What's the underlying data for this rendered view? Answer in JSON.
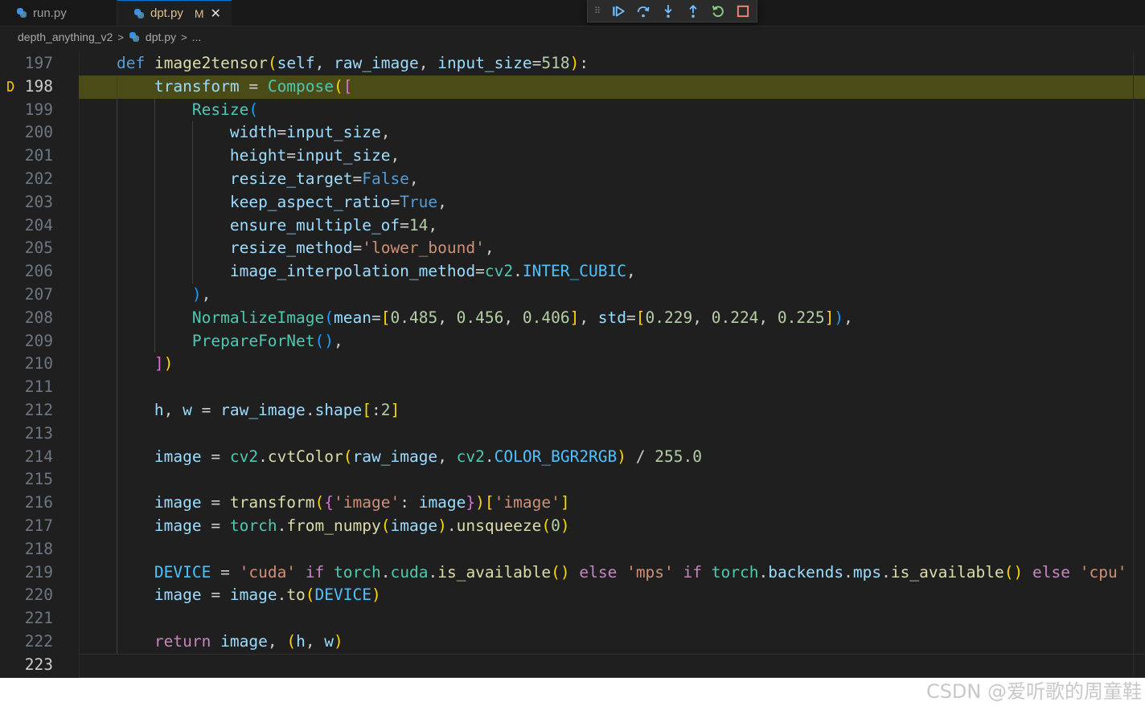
{
  "tabs": [
    {
      "label": "run.py",
      "active": false
    },
    {
      "label": "dpt.py",
      "active": true,
      "badge": "M",
      "close": "✕"
    }
  ],
  "breadcrumb": {
    "folder": "depth_anything_v2",
    "file": "dpt.py",
    "symbol": "..."
  },
  "debug_toolbar": [
    {
      "name": "continue",
      "icon": "continue-icon"
    },
    {
      "name": "step-over",
      "icon": "step-over-icon"
    },
    {
      "name": "step-into",
      "icon": "step-into-icon"
    },
    {
      "name": "step-out",
      "icon": "step-out-icon"
    },
    {
      "name": "restart",
      "icon": "restart-icon"
    },
    {
      "name": "stop",
      "icon": "stop-icon"
    }
  ],
  "colors": {
    "editor_bg": "#1f1f1f",
    "current_line": "#4b4b18",
    "breakpoint": "#ffcc00",
    "debug_continue": "#75beff",
    "debug_restart": "#89d185",
    "debug_stop": "#f48771"
  },
  "code": {
    "current_line": 198,
    "lines": [
      {
        "n": "197",
        "t": [
          [
            "    ",
            ""
          ],
          [
            "def",
            "kw"
          ],
          [
            " ",
            ""
          ],
          [
            "image2tensor",
            "fn"
          ],
          [
            "(",
            "b1"
          ],
          [
            "self",
            "var"
          ],
          [
            ", ",
            "pn"
          ],
          [
            "raw_image",
            "var"
          ],
          [
            ", ",
            "pn"
          ],
          [
            "input_size",
            "var"
          ],
          [
            "=",
            "pn"
          ],
          [
            "518",
            "num"
          ],
          [
            ")",
            "b1"
          ],
          [
            ":",
            "pn"
          ]
        ]
      },
      {
        "n": "198",
        "t": [
          [
            "        ",
            ""
          ],
          [
            "transform",
            "var"
          ],
          [
            " = ",
            "pn"
          ],
          [
            "Compose",
            "cls"
          ],
          [
            "(",
            "b1"
          ],
          [
            "[",
            "b2"
          ]
        ]
      },
      {
        "n": "199",
        "t": [
          [
            "            ",
            ""
          ],
          [
            "Resize",
            "cls"
          ],
          [
            "(",
            "b3"
          ]
        ]
      },
      {
        "n": "200",
        "t": [
          [
            "                ",
            ""
          ],
          [
            "width",
            "var"
          ],
          [
            "=",
            "pn"
          ],
          [
            "input_size",
            "var"
          ],
          [
            ",",
            "pn"
          ]
        ]
      },
      {
        "n": "201",
        "t": [
          [
            "                ",
            ""
          ],
          [
            "height",
            "var"
          ],
          [
            "=",
            "pn"
          ],
          [
            "input_size",
            "var"
          ],
          [
            ",",
            "pn"
          ]
        ]
      },
      {
        "n": "202",
        "t": [
          [
            "                ",
            ""
          ],
          [
            "resize_target",
            "var"
          ],
          [
            "=",
            "pn"
          ],
          [
            "False",
            "bool"
          ],
          [
            ",",
            "pn"
          ]
        ]
      },
      {
        "n": "203",
        "t": [
          [
            "                ",
            ""
          ],
          [
            "keep_aspect_ratio",
            "var"
          ],
          [
            "=",
            "pn"
          ],
          [
            "True",
            "bool"
          ],
          [
            ",",
            "pn"
          ]
        ]
      },
      {
        "n": "204",
        "t": [
          [
            "                ",
            ""
          ],
          [
            "ensure_multiple_of",
            "var"
          ],
          [
            "=",
            "pn"
          ],
          [
            "14",
            "num"
          ],
          [
            ",",
            "pn"
          ]
        ]
      },
      {
        "n": "205",
        "t": [
          [
            "                ",
            ""
          ],
          [
            "resize_method",
            "var"
          ],
          [
            "=",
            "pn"
          ],
          [
            "'lower_bound'",
            "str"
          ],
          [
            ",",
            "pn"
          ]
        ]
      },
      {
        "n": "206",
        "t": [
          [
            "                ",
            ""
          ],
          [
            "image_interpolation_method",
            "var"
          ],
          [
            "=",
            "pn"
          ],
          [
            "cv2",
            "cls"
          ],
          [
            ".",
            "pn"
          ],
          [
            "INTER_CUBIC",
            "con"
          ],
          [
            ",",
            "pn"
          ]
        ]
      },
      {
        "n": "207",
        "t": [
          [
            "            ",
            ""
          ],
          [
            ")",
            "b3"
          ],
          [
            ",",
            "pn"
          ]
        ]
      },
      {
        "n": "208",
        "t": [
          [
            "            ",
            ""
          ],
          [
            "NormalizeImage",
            "cls"
          ],
          [
            "(",
            "b3"
          ],
          [
            "mean",
            "var"
          ],
          [
            "=",
            "pn"
          ],
          [
            "[",
            "b1"
          ],
          [
            "0.485",
            "num"
          ],
          [
            ", ",
            "pn"
          ],
          [
            "0.456",
            "num"
          ],
          [
            ", ",
            "pn"
          ],
          [
            "0.406",
            "num"
          ],
          [
            "]",
            "b1"
          ],
          [
            ", ",
            "pn"
          ],
          [
            "std",
            "var"
          ],
          [
            "=",
            "pn"
          ],
          [
            "[",
            "b1"
          ],
          [
            "0.229",
            "num"
          ],
          [
            ", ",
            "pn"
          ],
          [
            "0.224",
            "num"
          ],
          [
            ", ",
            "pn"
          ],
          [
            "0.225",
            "num"
          ],
          [
            "]",
            "b1"
          ],
          [
            ")",
            "b3"
          ],
          [
            ",",
            "pn"
          ]
        ]
      },
      {
        "n": "209",
        "t": [
          [
            "            ",
            ""
          ],
          [
            "PrepareForNet",
            "cls"
          ],
          [
            "(",
            "b3"
          ],
          [
            ")",
            "b3"
          ],
          [
            ",",
            "pn"
          ]
        ]
      },
      {
        "n": "210",
        "t": [
          [
            "        ",
            ""
          ],
          [
            "]",
            "b2"
          ],
          [
            ")",
            "b1"
          ]
        ]
      },
      {
        "n": "211",
        "t": []
      },
      {
        "n": "212",
        "t": [
          [
            "        ",
            ""
          ],
          [
            "h",
            "var"
          ],
          [
            ", ",
            "pn"
          ],
          [
            "w",
            "var"
          ],
          [
            " = ",
            "pn"
          ],
          [
            "raw_image",
            "var"
          ],
          [
            ".",
            "pn"
          ],
          [
            "shape",
            "var"
          ],
          [
            "[",
            "b1"
          ],
          [
            ":",
            "pn"
          ],
          [
            "2",
            "num"
          ],
          [
            "]",
            "b1"
          ]
        ]
      },
      {
        "n": "213",
        "t": []
      },
      {
        "n": "214",
        "t": [
          [
            "        ",
            ""
          ],
          [
            "image",
            "var"
          ],
          [
            " = ",
            "pn"
          ],
          [
            "cv2",
            "cls"
          ],
          [
            ".",
            "pn"
          ],
          [
            "cvtColor",
            "fn"
          ],
          [
            "(",
            "b1"
          ],
          [
            "raw_image",
            "var"
          ],
          [
            ", ",
            "pn"
          ],
          [
            "cv2",
            "cls"
          ],
          [
            ".",
            "pn"
          ],
          [
            "COLOR_BGR2RGB",
            "con"
          ],
          [
            ")",
            "b1"
          ],
          [
            " / ",
            "pn"
          ],
          [
            "255.0",
            "num"
          ]
        ]
      },
      {
        "n": "215",
        "t": []
      },
      {
        "n": "216",
        "t": [
          [
            "        ",
            ""
          ],
          [
            "image",
            "var"
          ],
          [
            " = ",
            "pn"
          ],
          [
            "transform",
            "fn"
          ],
          [
            "(",
            "b1"
          ],
          [
            "{",
            "b2"
          ],
          [
            "'image'",
            "str"
          ],
          [
            ": ",
            "pn"
          ],
          [
            "image",
            "var"
          ],
          [
            "}",
            "b2"
          ],
          [
            ")",
            "b1"
          ],
          [
            "[",
            "b1"
          ],
          [
            "'image'",
            "str"
          ],
          [
            "]",
            "b1"
          ]
        ]
      },
      {
        "n": "217",
        "t": [
          [
            "        ",
            ""
          ],
          [
            "image",
            "var"
          ],
          [
            " = ",
            "pn"
          ],
          [
            "torch",
            "cls"
          ],
          [
            ".",
            "pn"
          ],
          [
            "from_numpy",
            "fn"
          ],
          [
            "(",
            "b1"
          ],
          [
            "image",
            "var"
          ],
          [
            ")",
            "b1"
          ],
          [
            ".",
            "pn"
          ],
          [
            "unsqueeze",
            "fn"
          ],
          [
            "(",
            "b1"
          ],
          [
            "0",
            "num"
          ],
          [
            ")",
            "b1"
          ]
        ]
      },
      {
        "n": "218",
        "t": []
      },
      {
        "n": "219",
        "t": [
          [
            "        ",
            ""
          ],
          [
            "DEVICE",
            "con"
          ],
          [
            " = ",
            "pn"
          ],
          [
            "'cuda'",
            "str"
          ],
          [
            " ",
            ""
          ],
          [
            "if",
            "ctl"
          ],
          [
            " ",
            ""
          ],
          [
            "torch",
            "cls"
          ],
          [
            ".",
            "pn"
          ],
          [
            "cuda",
            "cls"
          ],
          [
            ".",
            "pn"
          ],
          [
            "is_available",
            "fn"
          ],
          [
            "(",
            "b1"
          ],
          [
            ")",
            "b1"
          ],
          [
            " ",
            ""
          ],
          [
            "else",
            "ctl"
          ],
          [
            " ",
            ""
          ],
          [
            "'mps'",
            "str"
          ],
          [
            " ",
            ""
          ],
          [
            "if",
            "ctl"
          ],
          [
            " ",
            ""
          ],
          [
            "torch",
            "cls"
          ],
          [
            ".",
            "pn"
          ],
          [
            "backends",
            "var"
          ],
          [
            ".",
            "pn"
          ],
          [
            "mps",
            "var"
          ],
          [
            ".",
            "pn"
          ],
          [
            "is_available",
            "fn"
          ],
          [
            "(",
            "b1"
          ],
          [
            ")",
            "b1"
          ],
          [
            " ",
            ""
          ],
          [
            "else",
            "ctl"
          ],
          [
            " ",
            ""
          ],
          [
            "'cpu'",
            "str"
          ]
        ]
      },
      {
        "n": "220",
        "t": [
          [
            "        ",
            ""
          ],
          [
            "image",
            "var"
          ],
          [
            " = ",
            "pn"
          ],
          [
            "image",
            "var"
          ],
          [
            ".",
            "pn"
          ],
          [
            "to",
            "fn"
          ],
          [
            "(",
            "b1"
          ],
          [
            "DEVICE",
            "con"
          ],
          [
            ")",
            "b1"
          ]
        ]
      },
      {
        "n": "221",
        "t": []
      },
      {
        "n": "222",
        "t": [
          [
            "        ",
            ""
          ],
          [
            "return",
            "ctl"
          ],
          [
            " ",
            ""
          ],
          [
            "image",
            "var"
          ],
          [
            ", ",
            "pn"
          ],
          [
            "(",
            "b1"
          ],
          [
            "h",
            "var"
          ],
          [
            ", ",
            "pn"
          ],
          [
            "w",
            "var"
          ],
          [
            ")",
            "b1"
          ]
        ]
      },
      {
        "n": "223",
        "t": []
      }
    ]
  },
  "watermark": "CSDN @爱听歌的周童鞋"
}
